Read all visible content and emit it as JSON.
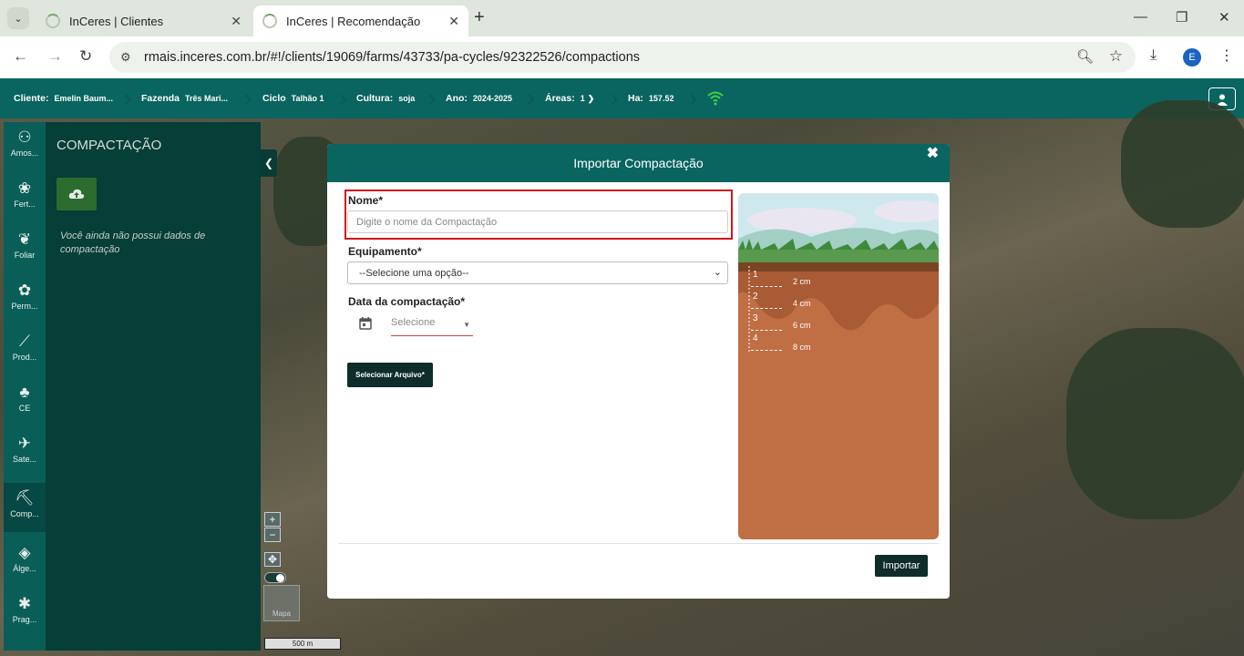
{
  "browser": {
    "tabs": [
      {
        "title": "InCeres | Clientes",
        "active": false
      },
      {
        "title": "InCeres | Recomendação",
        "active": true
      }
    ],
    "url": "rmais.inceres.com.br/#!/clients/19069/farms/43733/pa-cycles/92322526/compactions",
    "profile_initial": "E"
  },
  "header": {
    "cliente_label": "Cliente:",
    "cliente_value": "Emelin Baum...",
    "fazenda_label": "Fazenda",
    "fazenda_value": "Três Mari...",
    "ciclo_label": "Ciclo",
    "ciclo_value": "Talhão 1",
    "cultura_label": "Cultura:",
    "cultura_value": "soja",
    "ano_label": "Ano:",
    "ano_value": "2024-2025",
    "areas_label": "Áreas:",
    "areas_value": "1",
    "ha_label": "Ha:",
    "ha_value": "157.52"
  },
  "rail": {
    "items": [
      {
        "label": "Amos...",
        "icon": "soil-sample-icon"
      },
      {
        "label": "Fert...",
        "icon": "fertilizer-icon"
      },
      {
        "label": "Foliar",
        "icon": "leaf-icon"
      },
      {
        "label": "Perm...",
        "icon": "permanent-crop-icon"
      },
      {
        "label": "Prod...",
        "icon": "productivity-chart-icon"
      },
      {
        "label": "CE",
        "icon": "sprout-icon"
      },
      {
        "label": "Sate...",
        "icon": "satellite-icon"
      },
      {
        "label": "Comp...",
        "icon": "compaction-icon"
      },
      {
        "label": "Álge...",
        "icon": "layers-icon"
      },
      {
        "label": "Prag...",
        "icon": "bug-icon"
      }
    ]
  },
  "panel": {
    "title": "COMPACTAÇÃO",
    "empty_message": "Você ainda não possui dados de compactação"
  },
  "map": {
    "zoom_in": "+",
    "zoom_out": "−",
    "minimap_label": "Mapa",
    "scale": "500 m"
  },
  "modal": {
    "title": "Importar Compactação",
    "close": "✖",
    "name_label": "Nome*",
    "name_placeholder": "Digite o nome da Compactação",
    "equipment_label": "Equipamento*",
    "equipment_selected": "--Selecione uma opção--",
    "date_label": "Data da compactação*",
    "date_placeholder": "Selecione",
    "file_button": "Selecionar Arquivo*",
    "import_button": "Importar",
    "soil_layers": [
      {
        "num": "1",
        "depth": "2 cm"
      },
      {
        "num": "2",
        "depth": "4 cm"
      },
      {
        "num": "3",
        "depth": "6 cm"
      },
      {
        "num": "4",
        "depth": "8 cm"
      }
    ]
  },
  "colors": {
    "brand_teal": "#0a6460",
    "panel_dark": "#063e38",
    "button_dark": "#0e2c2a",
    "highlight_red": "#d1141c",
    "soil_brown": "#c06e44"
  }
}
